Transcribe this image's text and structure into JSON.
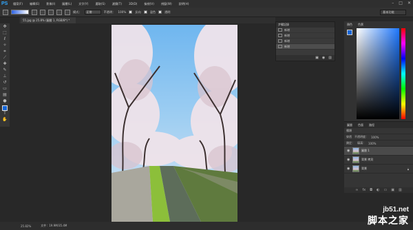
{
  "app": {
    "logo": "PS",
    "menu": [
      "檔案(F)",
      "編輯(E)",
      "影像(I)",
      "圖層(L)",
      "文字(Y)",
      "選取(S)",
      "濾鏡(T)",
      "3D(D)",
      "檢視(V)",
      "視窗(W)",
      "說明(H)"
    ],
    "window_controls": [
      "–",
      "□",
      "✕"
    ]
  },
  "options": {
    "mode_label": "模式：",
    "mode_value": "正常",
    "opacity_label": "不透明：",
    "opacity_value": "100%",
    "reverse_label": "反向",
    "dither_label": "混色",
    "transparency_label": "透明",
    "workspace": "基本功能"
  },
  "document": {
    "tab_title": "55.jpg @ 25.8% (圖層 1, RGB/8*) *"
  },
  "history": {
    "title": "步驟記錄",
    "items": [
      "新增",
      "新增",
      "新增",
      "新增"
    ]
  },
  "color_panel": {
    "tabs": [
      "顏色",
      "色票"
    ],
    "fg": "#1666d8"
  },
  "layers": {
    "tabs": [
      "圖層",
      "色版",
      "路徑"
    ],
    "kind_label": "種類",
    "blend": "穿透",
    "opacity_label": "不透明度：",
    "opacity_value": "100%",
    "lock_label": "鎖定：",
    "fill_label": "填滿：",
    "fill_value": "100%",
    "items": [
      {
        "name": "圖層 1"
      },
      {
        "name": "背景 拷貝"
      },
      {
        "name": "背景"
      }
    ]
  },
  "status": {
    "zoom": "25.82%",
    "doc_size": "文件：19.9M/35.4M"
  },
  "watermark": {
    "line1": "jb51.net",
    "line2": "脚本之家"
  }
}
